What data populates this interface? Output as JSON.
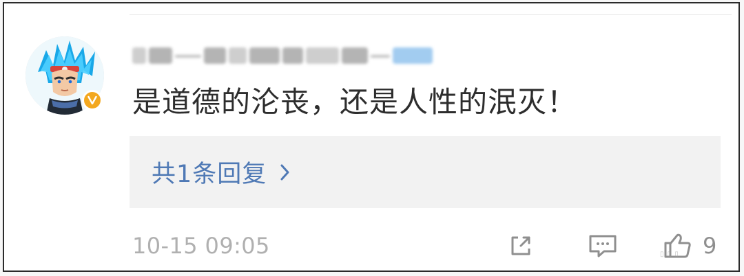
{
  "comment": {
    "text": "是道德的沦丧，还是人性的泯灭！",
    "reply_summary": "共1条回复",
    "timestamp": "10-15 09:05",
    "likes": "9"
  },
  "icons": {
    "verified": "verified-badge-icon",
    "chevron": "chevron-right-icon",
    "share": "share-icon",
    "comment": "comment-icon",
    "like": "thumbs-up-icon"
  },
  "colors": {
    "reply_link": "#4f79b5",
    "verified_badge": "#f3a81f",
    "timestamp": "#b0b0b0",
    "icon": "#8f8f8f"
  }
}
